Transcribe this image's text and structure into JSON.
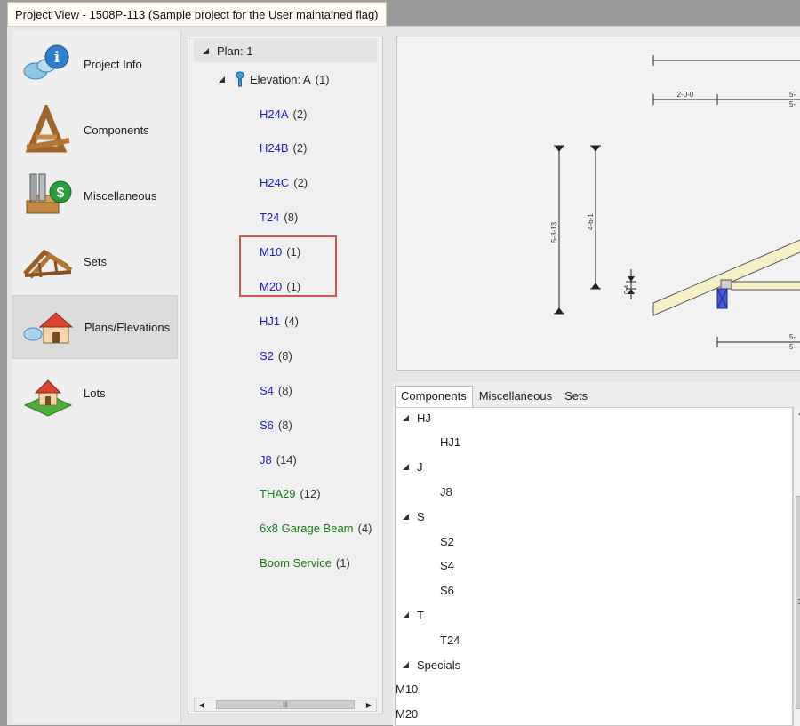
{
  "window": {
    "title": "Project View - 1508P-113 (Sample project for the User maintained flag)"
  },
  "nav": {
    "items": [
      {
        "label": "Project Info",
        "icon": "project-info-icon"
      },
      {
        "label": "Components",
        "icon": "truss-components-icon"
      },
      {
        "label": "Miscellaneous",
        "icon": "miscellaneous-hardware-icon"
      },
      {
        "label": "Sets",
        "icon": "truss-sets-icon"
      },
      {
        "label": "Plans/Elevations",
        "icon": "house-plans-icon",
        "selected": true
      },
      {
        "label": "Lots",
        "icon": "lot-house-icon"
      }
    ]
  },
  "tree": {
    "root": {
      "label": "Plan: 1"
    },
    "elevation": {
      "label": "Elevation: A",
      "count": "(1)"
    },
    "items": [
      {
        "name": "H24A",
        "count": "(2)",
        "color": "#1a1ad6"
      },
      {
        "name": "H24B",
        "count": "(2)",
        "color": "#1a1ad6"
      },
      {
        "name": "H24C",
        "count": "(2)",
        "color": "#1a1ad6"
      },
      {
        "name": "T24",
        "count": "(8)",
        "color": "#1a1ad6"
      },
      {
        "name": "M10",
        "count": "(1)",
        "color": "#1a1ad6"
      },
      {
        "name": "M20",
        "count": "(1)",
        "color": "#1a1ad6"
      },
      {
        "name": "HJ1",
        "count": "(4)",
        "color": "#1a1ad6"
      },
      {
        "name": "S2",
        "count": "(8)",
        "color": "#1a1ad6"
      },
      {
        "name": "S4",
        "count": "(8)",
        "color": "#1a1ad6"
      },
      {
        "name": "S6",
        "count": "(8)",
        "color": "#1a1ad6"
      },
      {
        "name": "J8",
        "count": "(14)",
        "color": "#1a1ad6"
      },
      {
        "name": "THA29",
        "count": "(12)",
        "color": "#1b7a1b"
      },
      {
        "name": "6x8 Garage Beam",
        "count": "(4)",
        "color": "#1b7a1b"
      },
      {
        "name": "Boom Service",
        "count": "(1)",
        "color": "#1b7a1b"
      }
    ]
  },
  "drawing": {
    "dims": {
      "top_left": "2-0-0",
      "top_right_a": "5-",
      "top_right_b": "5-",
      "vert_1": "5-3-13",
      "vert_2": "4-6-1",
      "vert_3": "0-4",
      "bottom_a": "5-",
      "bottom_b": "5-"
    }
  },
  "bottom_tabs": {
    "tabs": [
      "Components",
      "Miscellaneous",
      "Sets"
    ],
    "active": "Components",
    "list": [
      {
        "type": "group",
        "text": "HJ"
      },
      {
        "type": "leaf",
        "text": "HJ1"
      },
      {
        "type": "group",
        "text": "J"
      },
      {
        "type": "leaf",
        "text": "J8"
      },
      {
        "type": "group",
        "text": "S"
      },
      {
        "type": "leaf",
        "text": "S2"
      },
      {
        "type": "leaf",
        "text": "S4"
      },
      {
        "type": "leaf",
        "text": "S6"
      },
      {
        "type": "group",
        "text": "T"
      },
      {
        "type": "leaf",
        "text": "T24"
      },
      {
        "type": "group",
        "text": "Specials"
      },
      {
        "type": "selected",
        "text": "M10"
      },
      {
        "type": "selected",
        "text": "M20"
      }
    ]
  }
}
